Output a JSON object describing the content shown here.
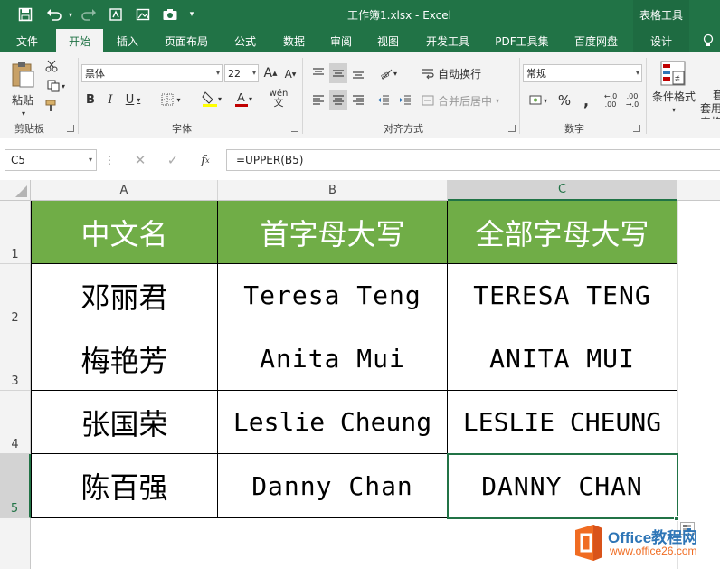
{
  "window": {
    "title": "工作簿1.xlsx - Excel",
    "context_tab_group": "表格工具"
  },
  "tabs": [
    "文件",
    "开始",
    "插入",
    "页面布局",
    "公式",
    "数据",
    "审阅",
    "视图",
    "开发工具",
    "PDF工具集",
    "百度网盘",
    "设计"
  ],
  "active_tab": "开始",
  "ribbon": {
    "clipboard": {
      "label": "剪贴板",
      "paste": "粘贴"
    },
    "font": {
      "label": "字体",
      "font_name": "黑体",
      "font_size": "22",
      "phonetic": "wén"
    },
    "alignment": {
      "label": "对齐方式",
      "wrap_text": "自动换行",
      "merge_center": "合并后居中"
    },
    "number": {
      "label": "数字",
      "format": "常规"
    },
    "styles": {
      "conditional_format": "条件格式",
      "table_format": "套用表格"
    }
  },
  "formula_bar": {
    "name_box": "C5",
    "formula": "=UPPER(B5)"
  },
  "columns": [
    "A",
    "B",
    "C"
  ],
  "rows": [
    "1",
    "2",
    "3",
    "4",
    "5"
  ],
  "selected_cell": {
    "col": "C",
    "row": "5"
  },
  "table": {
    "headers": [
      "中文名",
      "首字母大写",
      "全部字母大写"
    ],
    "rows": [
      [
        "邓丽君",
        "Teresa Teng",
        "TERESA TENG"
      ],
      [
        "梅艳芳",
        "Anita Mui",
        "ANITA MUI"
      ],
      [
        "张国荣",
        "Leslie Cheung",
        "LESLIE CHEUNG"
      ],
      [
        "陈百强",
        "Danny Chan",
        "DANNY CHAN"
      ]
    ]
  },
  "watermark": {
    "brand": "Office教程网",
    "url": "www.office26.com"
  },
  "colors": {
    "excel_green": "#217346",
    "header_fill": "#70ad47",
    "watermark_orange": "#f06c22",
    "watermark_blue": "#2e75b6"
  }
}
